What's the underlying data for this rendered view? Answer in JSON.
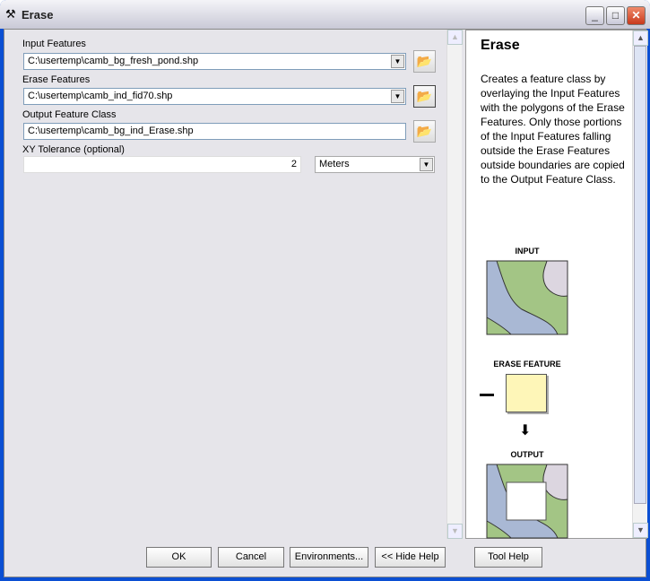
{
  "window": {
    "title": "Erase",
    "icon": "hammer-icon"
  },
  "form": {
    "input_features": {
      "label": "Input Features",
      "value": "C:\\usertemp\\camb_bg_fresh_pond.shp"
    },
    "erase_features": {
      "label": "Erase Features",
      "value": "C:\\usertemp\\camb_ind_fid70.shp"
    },
    "output_feature_class": {
      "label": "Output Feature Class",
      "value": "C:\\usertemp\\camb_bg_ind_Erase.shp"
    },
    "xy_tolerance": {
      "label": "XY Tolerance (optional)",
      "value": "2",
      "unit": "Meters"
    }
  },
  "help": {
    "title": "Erase",
    "description": "Creates a feature class by overlaying the Input Features with the polygons of the Erase Features. Only those portions of the Input Features falling outside the Erase Features outside boundaries are copied to the Output Feature Class.",
    "diagram": {
      "input_label": "INPUT",
      "erase_label": "ERASE FEATURE",
      "output_label": "OUTPUT",
      "minus": "–"
    },
    "colors": {
      "green": "#a3c585",
      "blue": "#a9b8d4",
      "lilac": "#dcd6e0",
      "yellow": "#fef6b8"
    }
  },
  "buttons": {
    "ok": "OK",
    "cancel": "Cancel",
    "environments": "Environments...",
    "hide_help": "<< Hide Help",
    "tool_help": "Tool Help"
  }
}
